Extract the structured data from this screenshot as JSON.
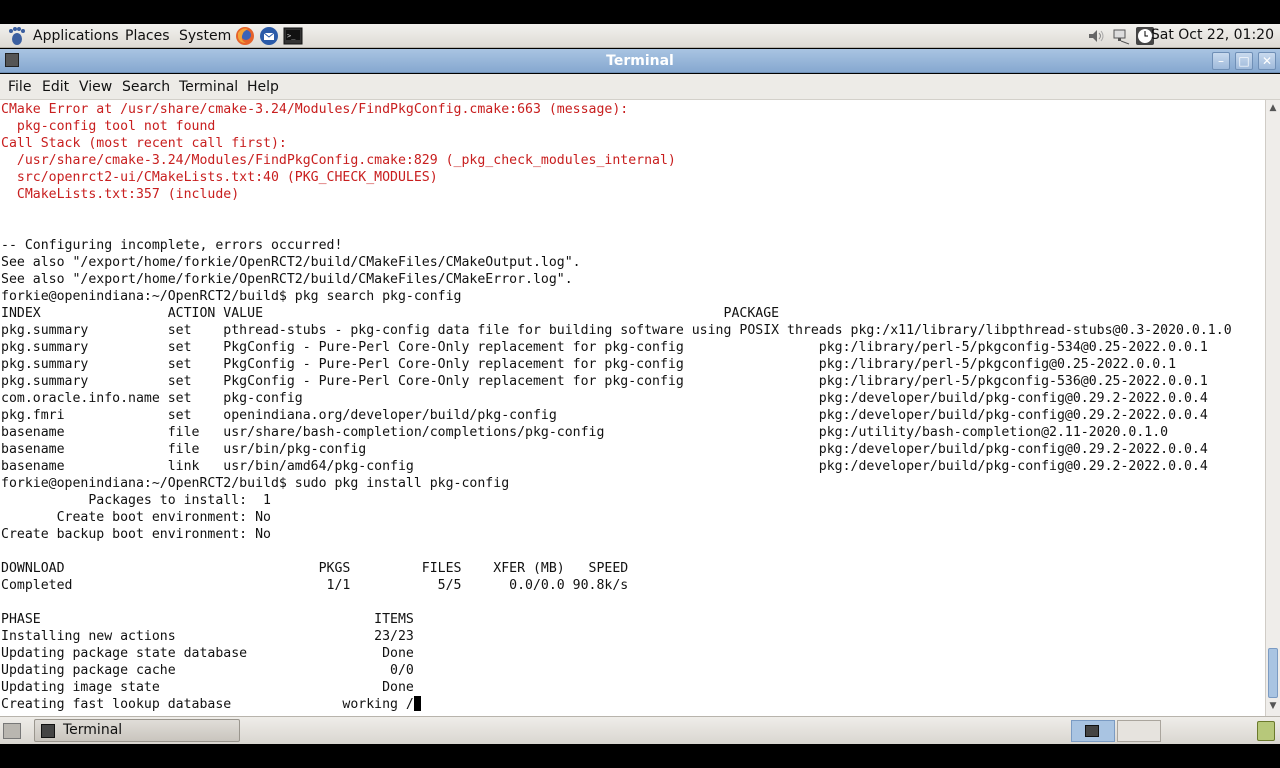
{
  "top_panel": {
    "menus": [
      "Applications",
      "Places",
      "System"
    ],
    "launchers": [
      "firefox-icon",
      "thunderbird-icon",
      "terminal-launcher-icon"
    ],
    "tray_icons": [
      "volume-icon",
      "network-icon",
      "clock-applet-icon"
    ],
    "clock": "Sat Oct 22, 01:20"
  },
  "window": {
    "title": "Terminal",
    "buttons": [
      "minimize-icon",
      "maximize-icon",
      "close-icon"
    ]
  },
  "menubar": [
    "File",
    "Edit",
    "View",
    "Search",
    "Terminal",
    "Help"
  ],
  "terminal": {
    "lines": [
      {
        "text": "CMake Error at /usr/share/cmake-3.24/Modules/FindPkgConfig.cmake:663 (message):",
        "error": true
      },
      {
        "text": "  pkg-config tool not found",
        "error": true
      },
      {
        "text": "Call Stack (most recent call first):",
        "error": true
      },
      {
        "text": "  /usr/share/cmake-3.24/Modules/FindPkgConfig.cmake:829 (_pkg_check_modules_internal)",
        "error": true
      },
      {
        "text": "  src/openrct2-ui/CMakeLists.txt:40 (PKG_CHECK_MODULES)",
        "error": true
      },
      {
        "text": "  CMakeLists.txt:357 (include)",
        "error": true
      },
      {
        "text": "",
        "error": false
      },
      {
        "text": "",
        "error": false
      },
      {
        "text": "-- Configuring incomplete, errors occurred!",
        "error": false
      },
      {
        "text": "See also \"/export/home/forkie/OpenRCT2/build/CMakeFiles/CMakeOutput.log\".",
        "error": false
      },
      {
        "text": "See also \"/export/home/forkie/OpenRCT2/build/CMakeFiles/CMakeError.log\".",
        "error": false
      },
      {
        "text": "forkie@openindiana:~/OpenRCT2/build$ pkg search pkg-config",
        "error": false
      },
      {
        "text": "INDEX                ACTION VALUE                                                          PACKAGE",
        "error": false
      },
      {
        "text": "pkg.summary          set    pthread-stubs - pkg-config data file for building software using POSIX threads pkg:/x11/library/libpthread-stubs@0.3-2020.0.1.0",
        "error": false
      },
      {
        "text": "pkg.summary          set    PkgConfig - Pure-Perl Core-Only replacement for pkg-config                 pkg:/library/perl-5/pkgconfig-534@0.25-2022.0.0.1",
        "error": false
      },
      {
        "text": "pkg.summary          set    PkgConfig - Pure-Perl Core-Only replacement for pkg-config                 pkg:/library/perl-5/pkgconfig@0.25-2022.0.0.1",
        "error": false
      },
      {
        "text": "pkg.summary          set    PkgConfig - Pure-Perl Core-Only replacement for pkg-config                 pkg:/library/perl-5/pkgconfig-536@0.25-2022.0.0.1",
        "error": false
      },
      {
        "text": "com.oracle.info.name set    pkg-config                                                                 pkg:/developer/build/pkg-config@0.29.2-2022.0.0.4",
        "error": false
      },
      {
        "text": "pkg.fmri             set    openindiana.org/developer/build/pkg-config                                 pkg:/developer/build/pkg-config@0.29.2-2022.0.0.4",
        "error": false
      },
      {
        "text": "basename             file   usr/share/bash-completion/completions/pkg-config                           pkg:/utility/bash-completion@2.11-2020.0.1.0",
        "error": false
      },
      {
        "text": "basename             file   usr/bin/pkg-config                                                         pkg:/developer/build/pkg-config@0.29.2-2022.0.0.4",
        "error": false
      },
      {
        "text": "basename             link   usr/bin/amd64/pkg-config                                                   pkg:/developer/build/pkg-config@0.29.2-2022.0.0.4",
        "error": false
      },
      {
        "text": "forkie@openindiana:~/OpenRCT2/build$ sudo pkg install pkg-config",
        "error": false
      },
      {
        "text": "           Packages to install:  1",
        "error": false
      },
      {
        "text": "       Create boot environment: No",
        "error": false
      },
      {
        "text": "Create backup boot environment: No",
        "error": false
      },
      {
        "text": "",
        "error": false
      },
      {
        "text": "DOWNLOAD                                PKGS         FILES    XFER (MB)   SPEED",
        "error": false
      },
      {
        "text": "Completed                                1/1           5/5      0.0/0.0 90.8k/s",
        "error": false
      },
      {
        "text": "",
        "error": false
      },
      {
        "text": "PHASE                                          ITEMS",
        "error": false
      },
      {
        "text": "Installing new actions                         23/23",
        "error": false
      },
      {
        "text": "Updating package state database                 Done",
        "error": false
      },
      {
        "text": "Updating package cache                           0/0",
        "error": false
      },
      {
        "text": "Updating image state                            Done",
        "error": false
      },
      {
        "text": "Creating fast lookup database              working /",
        "error": false,
        "cursor": true
      }
    ]
  },
  "bottom_panel": {
    "task_label": "Terminal",
    "icons": [
      "show-desktop-icon",
      "workspace-switcher",
      "trash-icon"
    ]
  }
}
